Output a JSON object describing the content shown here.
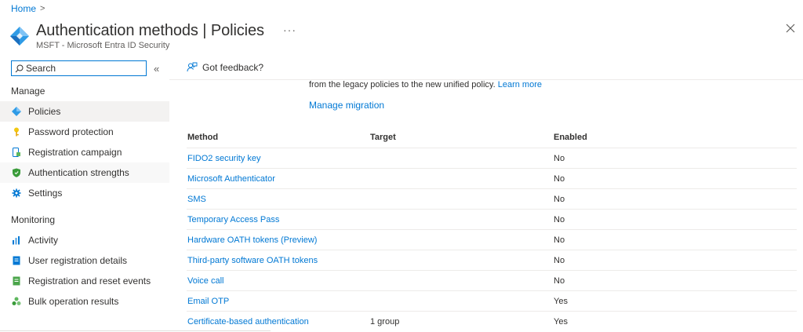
{
  "breadcrumb": {
    "home": "Home",
    "sep": ">"
  },
  "header": {
    "title": "Authentication methods | Policies",
    "subtitle": "MSFT - Microsoft Entra ID Security",
    "more": "···"
  },
  "sidebar": {
    "search_placeholder": "Search",
    "collapse": "«",
    "manage_heading": "Manage",
    "monitoring_heading": "Monitoring",
    "manage_items": [
      {
        "label": "Policies",
        "icon": "diamond-icon",
        "active": true
      },
      {
        "label": "Password protection",
        "icon": "key-icon"
      },
      {
        "label": "Registration campaign",
        "icon": "device-icon"
      },
      {
        "label": "Authentication strengths",
        "icon": "shield-icon"
      },
      {
        "label": "Settings",
        "icon": "gear-icon"
      }
    ],
    "monitoring_items": [
      {
        "label": "Activity",
        "icon": "bar-chart-icon"
      },
      {
        "label": "User registration details",
        "icon": "document-icon"
      },
      {
        "label": "Registration and reset events",
        "icon": "log-icon"
      },
      {
        "label": "Bulk operation results",
        "icon": "people-icon"
      }
    ]
  },
  "toolbar": {
    "feedback": "Got feedback?"
  },
  "content": {
    "intro_text": "from the legacy policies to the new unified policy.",
    "learn_more": "Learn more",
    "manage_migration": "Manage migration"
  },
  "table": {
    "headers": {
      "method": "Method",
      "target": "Target",
      "enabled": "Enabled"
    },
    "rows": [
      {
        "method": "FIDO2 security key",
        "target": "",
        "enabled": "No"
      },
      {
        "method": "Microsoft Authenticator",
        "target": "",
        "enabled": "No"
      },
      {
        "method": "SMS",
        "target": "",
        "enabled": "No"
      },
      {
        "method": "Temporary Access Pass",
        "target": "",
        "enabled": "No"
      },
      {
        "method": "Hardware OATH tokens (Preview)",
        "target": "",
        "enabled": "No"
      },
      {
        "method": "Third-party software OATH tokens",
        "target": "",
        "enabled": "No"
      },
      {
        "method": "Voice call",
        "target": "",
        "enabled": "No"
      },
      {
        "method": "Email OTP",
        "target": "",
        "enabled": "Yes"
      },
      {
        "method": "Certificate-based authentication",
        "target": "1 group",
        "enabled": "Yes"
      }
    ]
  },
  "colors": {
    "accent": "#0078d4",
    "active_bg": "#f3f2f1"
  }
}
